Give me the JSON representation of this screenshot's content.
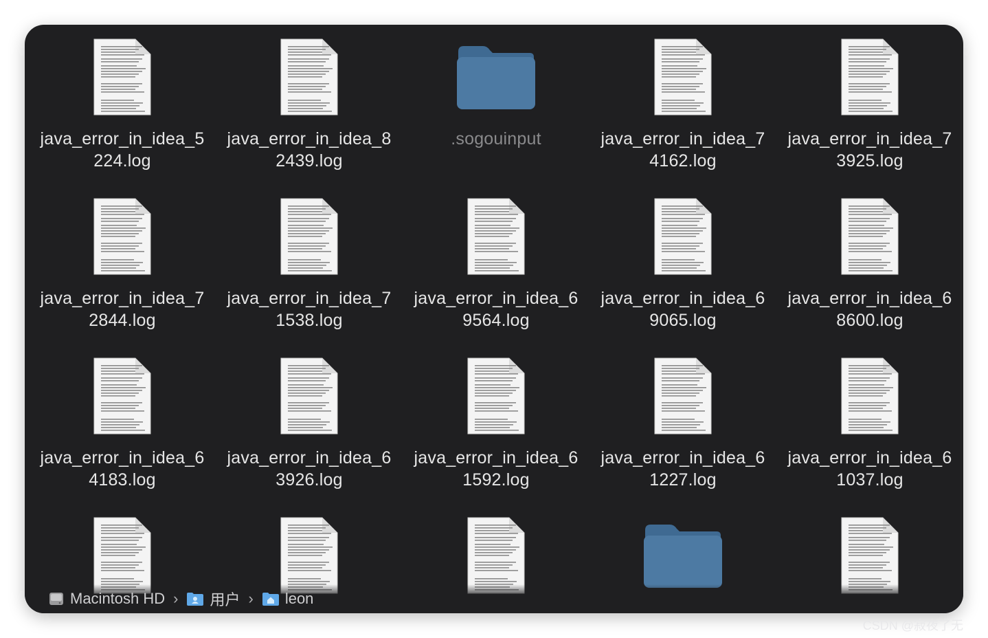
{
  "files": [
    {
      "name": "java_error_in_idea_5\n224.log",
      "type": "doc"
    },
    {
      "name": "java_error_in_idea_8\n2439.log",
      "type": "doc"
    },
    {
      "name": ".sogouinput",
      "type": "folder",
      "hidden": true
    },
    {
      "name": "java_error_in_idea_7\n4162.log",
      "type": "doc"
    },
    {
      "name": "java_error_in_idea_7\n3925.log",
      "type": "doc"
    },
    {
      "name": "java_error_in_idea_7\n2844.log",
      "type": "doc"
    },
    {
      "name": "java_error_in_idea_7\n1538.log",
      "type": "doc"
    },
    {
      "name": "java_error_in_idea_6\n9564.log",
      "type": "doc"
    },
    {
      "name": "java_error_in_idea_6\n9065.log",
      "type": "doc"
    },
    {
      "name": "java_error_in_idea_6\n8600.log",
      "type": "doc"
    },
    {
      "name": "java_error_in_idea_6\n4183.log",
      "type": "doc"
    },
    {
      "name": "java_error_in_idea_6\n3926.log",
      "type": "doc"
    },
    {
      "name": "java_error_in_idea_6\n1592.log",
      "type": "doc"
    },
    {
      "name": "java_error_in_idea_6\n1227.log",
      "type": "doc"
    },
    {
      "name": "java_error_in_idea_6\n1037.log",
      "type": "doc"
    },
    {
      "name": "",
      "type": "doc"
    },
    {
      "name": "",
      "type": "doc"
    },
    {
      "name": "",
      "type": "doc"
    },
    {
      "name": "",
      "type": "folder"
    },
    {
      "name": "",
      "type": "doc"
    }
  ],
  "pathbar": {
    "items": [
      {
        "label": "Macintosh HD",
        "icon": "hard-drive-icon"
      },
      {
        "label": "用户",
        "icon": "users-folder-icon"
      },
      {
        "label": "leon",
        "icon": "home-folder-icon"
      }
    ],
    "separator": "›"
  },
  "watermark": "CSDN @寂夜了无",
  "colors": {
    "window_bg": "#1f1f21",
    "folder": "#4d7aa3",
    "folder_tab": "#3f6a92",
    "label": "#e6e6e6"
  }
}
